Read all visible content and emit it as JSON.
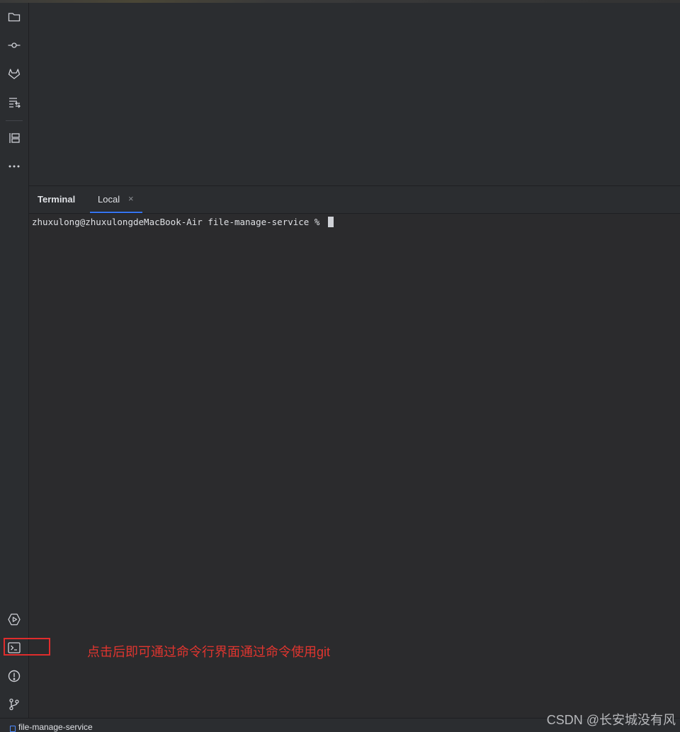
{
  "sidebar": {
    "top_icons": [
      "folder-icon",
      "commit-icon",
      "gitlab-icon",
      "pull-requests-icon",
      "structure-icon",
      "more-icon"
    ],
    "bottom_icons": [
      "run-icon",
      "terminal-icon",
      "problems-icon",
      "git-branch-icon"
    ]
  },
  "terminal": {
    "title": "Terminal",
    "tab_label": "Local",
    "close_glyph": "×",
    "prompt": "zhuxulong@zhuxulongdeMacBook-Air file-manage-service % "
  },
  "annotation": {
    "text": "点击后即可通过命令行界面通过命令使用git",
    "color": "#e0352f"
  },
  "status_bar": {
    "project": "file-manage-service"
  },
  "watermark": "CSDN @长安城没有风",
  "colors": {
    "accent": "#3574f0",
    "background": "#2b2b2d",
    "highlight_border": "#e02c2c"
  }
}
